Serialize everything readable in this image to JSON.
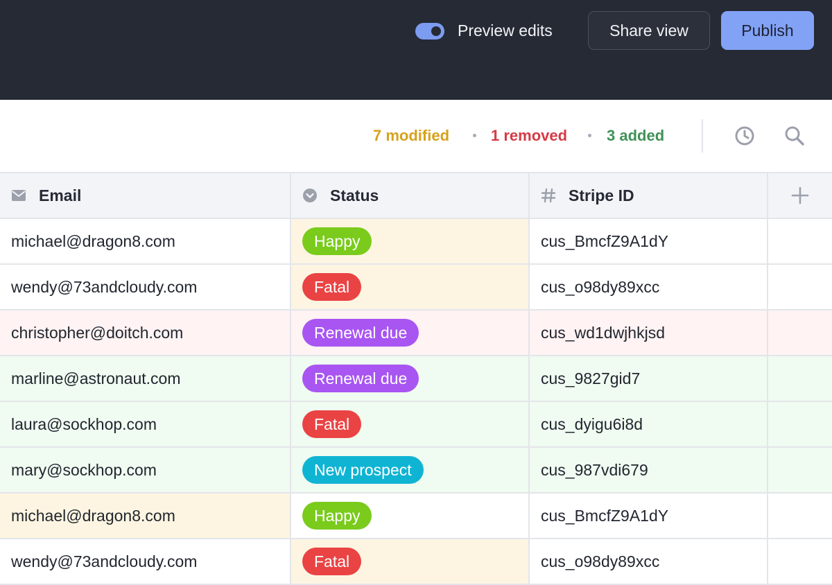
{
  "topbar": {
    "preview_toggle": {
      "label": "Preview edits",
      "on": true
    },
    "share_button": "Share view",
    "publish_button": "Publish"
  },
  "changes": {
    "modified": "7 modified",
    "removed": "1 removed",
    "added": "3 added",
    "colors": {
      "modified": "#d6a11c",
      "removed": "#d63a44",
      "added": "#3f9158"
    },
    "icons": [
      "history-icon",
      "search-icon"
    ]
  },
  "table": {
    "columns": [
      {
        "label": "Email",
        "icon": "envelope-icon"
      },
      {
        "label": "Status",
        "icon": "chevron-circle-icon"
      },
      {
        "label": "Stripe ID",
        "icon": "hash-icon"
      }
    ],
    "add_column_icon": "plus-icon",
    "rows": [
      {
        "email": "michael@dragon8.com",
        "status": "Happy",
        "stripe_id": "cus_BmcfZ9A1dY",
        "change": "modified",
        "changed_cell": "status"
      },
      {
        "email": "wendy@73andcloudy.com",
        "status": "Fatal",
        "stripe_id": "cus_o98dy89xcc",
        "change": "modified",
        "changed_cell": "status"
      },
      {
        "email": "christopher@doitch.com",
        "status": "Renewal due",
        "stripe_id": "cus_wd1dwjhkjsd",
        "change": "removed",
        "changed_cell": "row"
      },
      {
        "email": "marline@astronaut.com",
        "status": "Renewal due",
        "stripe_id": "cus_9827gid7",
        "change": "added",
        "changed_cell": "row"
      },
      {
        "email": "laura@sockhop.com",
        "status": "Fatal",
        "stripe_id": "cus_dyigu6i8d",
        "change": "added",
        "changed_cell": "row"
      },
      {
        "email": "mary@sockhop.com",
        "status": "New prospect",
        "stripe_id": "cus_987vdi679",
        "change": "added",
        "changed_cell": "row"
      },
      {
        "email": "michael@dragon8.com",
        "status": "Happy",
        "stripe_id": "cus_BmcfZ9A1dY",
        "change": "modified",
        "changed_cell": "email"
      },
      {
        "email": "wendy@73andcloudy.com",
        "status": "Fatal",
        "stripe_id": "cus_o98dy89xcc",
        "change": "modified",
        "changed_cell": "status"
      }
    ]
  },
  "status_colors": {
    "Happy": "#7acb1c",
    "Fatal": "#ea4344",
    "Renewal due": "#a855f2",
    "New prospect": "#10b4d3"
  },
  "highlight_colors": {
    "modified": "#fdf5e1",
    "removed": "#fff3f3",
    "added": "#f0fbf1"
  }
}
